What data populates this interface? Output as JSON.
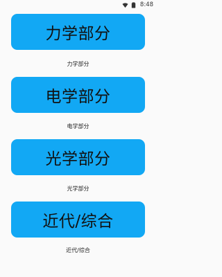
{
  "status_bar": {
    "time": "8:48",
    "icons": [
      "wifi-icon",
      "battery-icon"
    ]
  },
  "colors": {
    "button_bg": "#12a8f4",
    "background": "#fafafa"
  },
  "sections": [
    {
      "button_label": "力学部分",
      "caption": "力学部分"
    },
    {
      "button_label": "电学部分",
      "caption": "电学部分"
    },
    {
      "button_label": "光学部分",
      "caption": "光学部分"
    },
    {
      "button_label": "近代/综合",
      "caption": "近代/综合"
    }
  ]
}
